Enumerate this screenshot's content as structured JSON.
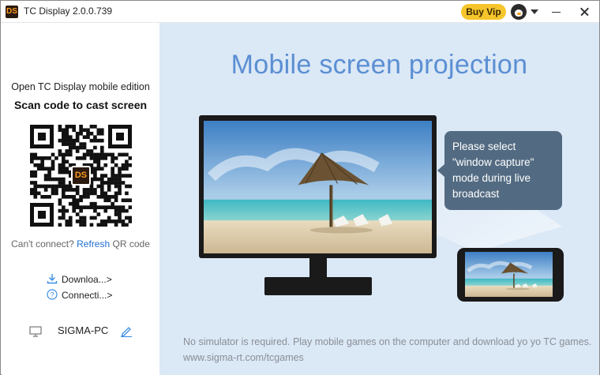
{
  "window": {
    "title": "TC Display 2.0.0.739",
    "app_icon_text": "DS"
  },
  "header": {
    "vip_label": "Buy Vip",
    "avatar_icon": "penguin-avatar-icon",
    "dropdown_icon": "chevron-down-icon",
    "minimize_icon": "minimize-icon",
    "close_icon": "close-icon"
  },
  "sidebar": {
    "open_text": "Open TC Display mobile edition",
    "scan_text": "Scan code to cast screen",
    "qr_logo_text": "DS",
    "cant_connect": "Can't connect?",
    "refresh_label": "Refresh",
    "qr_code_label": "QR code",
    "download_label": "Downloa...>",
    "connection_label": "Connecti...>",
    "pc_name": "SIGMA-PC"
  },
  "main": {
    "title": "Mobile screen projection",
    "tooltip": "Please select \"window capture\" mode during live broadcast",
    "footer": "No simulator is required. Play mobile games on the computer and download yo yo TC games. www.sigma-rt.com/tcgames"
  },
  "colors": {
    "accent_blue": "#5b8fd3",
    "main_bg": "#dbe8f6",
    "vip_yellow": "#f5c52b",
    "link_blue": "#1f6fd1",
    "tooltip_bg": "#536b82"
  }
}
